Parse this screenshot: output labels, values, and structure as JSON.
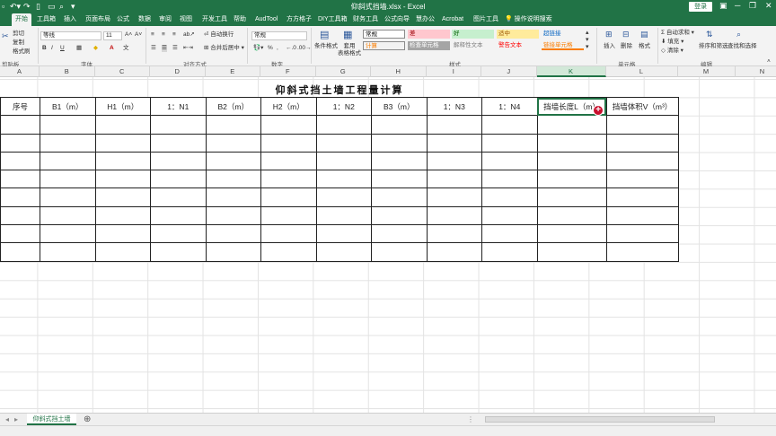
{
  "window": {
    "document_title": "仰斜式挡墙.xlsx - Excel",
    "login_label": "登录"
  },
  "ribbon_tabs": [
    "开始",
    "工具箱",
    "插入",
    "页面布局",
    "公式",
    "数据",
    "审阅",
    "视图",
    "开发工具",
    "帮助",
    "AudTool",
    "方方格子",
    "DIY工具箱",
    "财务工具",
    "公式向导",
    "慧办公",
    "Acrobat",
    "图片工具"
  ],
  "tell_me": "操作说明搜索",
  "ribbon": {
    "clipboard": {
      "cut": "剪切",
      "copy": "复制",
      "format_painter": "格式刷",
      "group": "剪贴板"
    },
    "font": {
      "name": "等线",
      "size": "11",
      "group": "字体",
      "bold": "B",
      "italic": "I",
      "underline": "U"
    },
    "alignment": {
      "wrap": "自动换行",
      "merge": "合并后居中",
      "group": "对齐方式"
    },
    "number": {
      "format": "常规",
      "group": "数字",
      "percent": "%"
    },
    "styles": {
      "conditional": "条件格式",
      "table": "套用\n表格格式",
      "group": "样式",
      "cells": [
        {
          "label": "常规",
          "bg": "#ffffff",
          "fg": "#000000"
        },
        {
          "label": "差",
          "bg": "#ffc7ce",
          "fg": "#9c0006"
        },
        {
          "label": "好",
          "bg": "#c6efce",
          "fg": "#006100"
        },
        {
          "label": "适中",
          "bg": "#ffeb9c",
          "fg": "#9c5700"
        },
        {
          "label": "超链接",
          "bg": "#f3f3f3",
          "fg": "#0563c1"
        },
        {
          "label": "计算",
          "bg": "#f2f2f2",
          "fg": "#fa7d00"
        },
        {
          "label": "检查单元格",
          "bg": "#a5a5a5",
          "fg": "#ffffff"
        },
        {
          "label": "解释性文本",
          "bg": "#f3f3f3",
          "fg": "#7f7f7f"
        },
        {
          "label": "警告文本",
          "bg": "#f3f3f3",
          "fg": "#ff0000"
        },
        {
          "label": "链接单元格",
          "bg": "#f3f3f3",
          "fg": "#fa7d00"
        }
      ]
    },
    "cells": {
      "insert": "插入",
      "delete": "删除",
      "format": "格式",
      "group": "单元格"
    },
    "editing": {
      "autosum": "自动求和",
      "fill": "填充",
      "clear": "清除",
      "sort": "排序和筛选",
      "find": "查找和选择",
      "group": "编辑"
    }
  },
  "columns": [
    "A",
    "B",
    "C",
    "D",
    "E",
    "F",
    "G",
    "H",
    "I",
    "J",
    "K",
    "L",
    "M",
    "N"
  ],
  "selected_column": "K",
  "sheet": {
    "title": "仰斜式挡土墙工程量计算",
    "headers": [
      "序号",
      "B1（m）",
      "H1（m）",
      "1：N1",
      "B2（m）",
      "H2（m）",
      "1：N2",
      "B3（m）",
      "1：N3",
      "1：N4",
      "挡墙长度L（m）",
      "挡墙体积V（m³）"
    ],
    "empty_rows": 8
  },
  "sheet_tab": "仰斜式挡土墙"
}
